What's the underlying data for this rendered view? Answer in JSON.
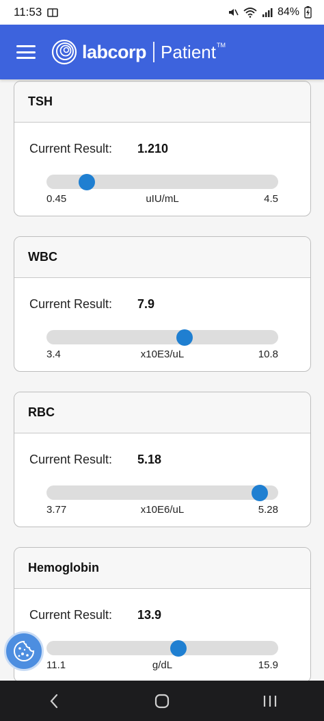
{
  "status_bar": {
    "time": "11:53",
    "battery": "84%"
  },
  "header": {
    "brand": "labcorp",
    "product": "Patient",
    "trademark": "TM"
  },
  "results": [
    {
      "name": "TSH",
      "label": "Current Result:",
      "value": "1.210",
      "min": "0.45",
      "max": "4.5",
      "unit": "uIU/mL",
      "position": 0.175
    },
    {
      "name": "WBC",
      "label": "Current Result:",
      "value": "7.9",
      "min": "3.4",
      "max": "10.8",
      "unit": "x10E3/uL",
      "position": 0.595
    },
    {
      "name": "RBC",
      "label": "Current Result:",
      "value": "5.18",
      "min": "3.77",
      "max": "5.28",
      "unit": "x10E6/uL",
      "position": 0.92
    },
    {
      "name": "Hemoglobin",
      "label": "Current Result:",
      "value": "13.9",
      "min": "11.1",
      "max": "15.9",
      "unit": "g/dL",
      "position": 0.57
    }
  ],
  "colors": {
    "header_bg": "#3d63dd",
    "thumb": "#1f7fd1",
    "track": "#dddddd"
  },
  "icons": {
    "cookie": "cookie-icon",
    "back": "back-icon",
    "home": "home-icon",
    "recents": "recents-icon"
  }
}
